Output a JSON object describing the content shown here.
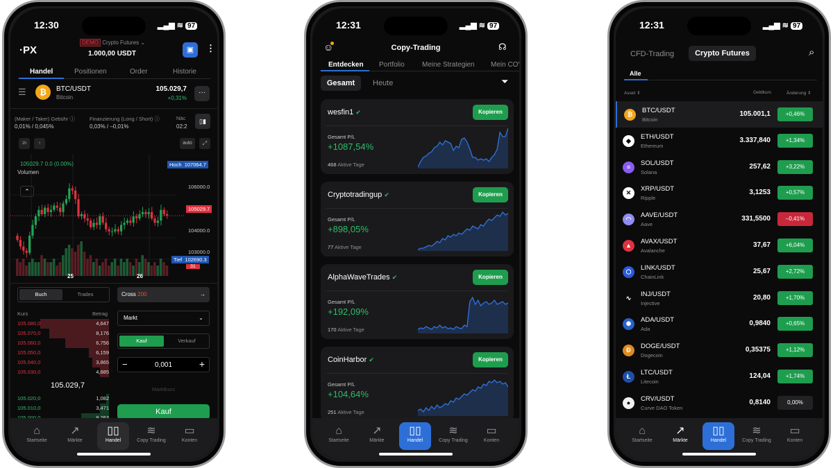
{
  "phone1": {
    "status": {
      "time": "12:30",
      "battery": "97"
    },
    "logo": "·PX",
    "account": {
      "badge": "DEMO",
      "product": "Crypto Futures",
      "balance": "1.000,00 USDT"
    },
    "tabs": [
      "Handel",
      "Positionen",
      "Order",
      "Historie"
    ],
    "pair": {
      "symbol": "BTC/USDT",
      "name": "Bitcoin",
      "price": "105.029,7",
      "change": "+0,31%"
    },
    "fees": {
      "label": "(Maker / Taker) Gebühr",
      "value": "0,01% / 0,045%"
    },
    "funding": {
      "label": "Finanzierung (Long / Short)",
      "value": "0,03% / –0,01%"
    },
    "next": {
      "label": "Näc",
      "value": "02:2"
    },
    "timeframe": "1h",
    "auto": "auto",
    "chart": {
      "last_line": "105029.7  0.0 (0.00%)",
      "volume_label": "Volumen",
      "high_label": "Hoch",
      "high": "107064.7",
      "low_label": "Tief",
      "low": "102690.3",
      "current": "105029.7",
      "countdown": "31",
      "axis": [
        "106000.0",
        "104000.0",
        "103000.0"
      ],
      "x_labels": [
        "25",
        "26"
      ],
      "closes": [
        103900,
        103600,
        103400,
        103300,
        104100,
        104600,
        105000,
        105300,
        105100,
        105400,
        105200,
        105300,
        105500,
        105400,
        105200,
        105600,
        105800,
        106300,
        106200,
        105800,
        105000,
        105100,
        104900,
        104800,
        104500,
        104700,
        104600,
        105000,
        104700,
        104400,
        104300,
        104300,
        104400,
        104300,
        104600,
        104700,
        104800,
        104700,
        105000,
        104900,
        105100,
        105200,
        105100,
        105200,
        104900,
        104700,
        104800,
        105300,
        105100,
        105030
      ],
      "volumes": [
        5,
        4,
        5,
        3,
        4,
        5,
        4,
        4,
        6,
        5,
        4,
        4,
        5,
        3,
        4,
        6,
        8,
        9,
        8,
        7,
        9,
        10,
        7,
        5,
        6,
        4,
        5,
        3,
        4,
        5,
        3,
        4,
        5,
        3,
        5,
        4,
        5,
        4,
        3,
        5,
        4,
        6,
        5,
        4,
        3,
        4,
        3,
        5,
        4,
        3
      ]
    },
    "book_tabs": [
      "Buch",
      "Trades"
    ],
    "book_headers": {
      "price": "Kurs",
      "amount": "Betrag"
    },
    "asks": [
      {
        "p": "105.080,0",
        "a": "4,647",
        "d": 0.75
      },
      {
        "p": "105.070,0",
        "a": "8,176",
        "d": 0.65
      },
      {
        "p": "105.060,0",
        "a": "6,756",
        "d": 0.48
      },
      {
        "p": "105.050,0",
        "a": "6,159",
        "d": 0.22
      },
      {
        "p": "105.040,0",
        "a": "3,865",
        "d": 0.18
      },
      {
        "p": "105.030,0",
        "a": "4,885",
        "d": 0.1
      }
    ],
    "mid": "105.029,7",
    "bids": [
      {
        "p": "105.020,0",
        "a": "1,082",
        "d": 0.03
      },
      {
        "p": "105.010,0",
        "a": "3,471",
        "d": 0.1
      },
      {
        "p": "105.000,0",
        "a": "9,763",
        "d": 0.3
      }
    ],
    "margin": {
      "mode": "Cross",
      "leverage": "200"
    },
    "order_type": "Markt",
    "side": {
      "buy": "Kauf",
      "sell": "Verkauf"
    },
    "qty": "0,001",
    "price_hint": "Marktkurs",
    "submit": "Kauf"
  },
  "phone2": {
    "status": {
      "time": "12:31",
      "battery": "97"
    },
    "title": "Copy-Trading",
    "tabs": [
      "Entdecken",
      "Portfolio",
      "Meine Strategien",
      "Mein COV"
    ],
    "filters": [
      "Gesamt",
      "Heute"
    ],
    "copy_label": "Kopieren",
    "pl_label": "Gesamt P/L",
    "days_label": "Aktive Tage",
    "traders": [
      {
        "name": "wesfin1",
        "pl": "+1087,54%",
        "days": "468",
        "spark": [
          0,
          8,
          14,
          16,
          20,
          22,
          28,
          30,
          36,
          32,
          38,
          36,
          34,
          24,
          30,
          28,
          40,
          42,
          36,
          26,
          14,
          14,
          10,
          12,
          10,
          12,
          8,
          14,
          18,
          26,
          50,
          44,
          44,
          56
        ]
      },
      {
        "name": "Cryptotradingup",
        "pl": "+898,05%",
        "days": "77",
        "spark": [
          0,
          2,
          2,
          4,
          6,
          5,
          8,
          12,
          10,
          16,
          14,
          20,
          18,
          22,
          20,
          24,
          22,
          26,
          30,
          28,
          34,
          32,
          30,
          36,
          34,
          40,
          44,
          42,
          46,
          50,
          48,
          54,
          50,
          52
        ]
      },
      {
        "name": "AlphaWaveTrades",
        "pl": "+192,09%",
        "days": "170",
        "spark": [
          4,
          6,
          5,
          8,
          6,
          4,
          8,
          6,
          10,
          6,
          8,
          5,
          6,
          4,
          8,
          6,
          5,
          10,
          8,
          44,
          50,
          40,
          46,
          38,
          42,
          44,
          40,
          42,
          46,
          40,
          42,
          44,
          40,
          42
        ]
      },
      {
        "name": "CoinHarbor",
        "pl": "+104,64%",
        "days": "251",
        "spark": [
          6,
          8,
          4,
          10,
          6,
          12,
          8,
          14,
          10,
          12,
          16,
          14,
          20,
          18,
          24,
          22,
          26,
          30,
          28,
          32,
          36,
          34,
          40,
          38,
          44,
          42,
          48,
          46,
          50,
          46,
          48,
          44,
          46,
          40
        ]
      }
    ]
  },
  "phone3": {
    "status": {
      "time": "12:31",
      "battery": "97"
    },
    "tabs": [
      "CFD-Trading",
      "Crypto Futures"
    ],
    "sub_tab": "Alle",
    "headers": {
      "asset": "Asset",
      "price": "Geldkurs",
      "change": "Änderung"
    },
    "assets": [
      {
        "s": "BTC/USDT",
        "n": "Bitcoin",
        "p": "105.001,1",
        "c": "+0,46%",
        "dir": "up",
        "color": "#f2a619",
        "g": "₿"
      },
      {
        "s": "ETH/USDT",
        "n": "Ethereum",
        "p": "3.337,840",
        "c": "+1,34%",
        "dir": "up",
        "color": "#ffffff",
        "g": "◆"
      },
      {
        "s": "SOL/USDT",
        "n": "Solana",
        "p": "257,62",
        "c": "+3,22%",
        "dir": "up",
        "color": "#8a5cf0",
        "g": "≡"
      },
      {
        "s": "XRP/USDT",
        "n": "Ripple",
        "p": "3,1253",
        "c": "+0,57%",
        "dir": "up",
        "color": "#ffffff",
        "g": "✕"
      },
      {
        "s": "AAVE/USDT",
        "n": "Aave",
        "p": "331,5500",
        "c": "–0,41%",
        "dir": "down",
        "color": "#8f8cf2",
        "g": "◠"
      },
      {
        "s": "AVAX/USDT",
        "n": "Avalanche",
        "p": "37,67",
        "c": "+6,04%",
        "dir": "up",
        "color": "#e0323f",
        "g": "▲"
      },
      {
        "s": "LINK/USDT",
        "n": "ChainLink",
        "p": "25,67",
        "c": "+2,72%",
        "dir": "up",
        "color": "#2a5ada",
        "g": "⬡"
      },
      {
        "s": "INJ/USDT",
        "n": "Injective",
        "p": "20,80",
        "c": "+1,70%",
        "dir": "up",
        "color": "#0b0b0c",
        "g": "∿"
      },
      {
        "s": "ADA/USDT",
        "n": "Ada",
        "p": "0,9840",
        "c": "+0,65%",
        "dir": "up",
        "color": "#2a62c9",
        "g": "✺"
      },
      {
        "s": "DOGE/USDT",
        "n": "Dogecoin",
        "p": "0,35375",
        "c": "+1,12%",
        "dir": "up",
        "color": "#e08a1e",
        "g": "Ð"
      },
      {
        "s": "LTC/USDT",
        "n": "Litecoin",
        "p": "124,04",
        "c": "+1,74%",
        "dir": "up",
        "color": "#1e4fa8",
        "g": "Ł"
      },
      {
        "s": "CRV/USDT",
        "n": "Curve DAO Token",
        "p": "0,8140",
        "c": "0,00%",
        "dir": "flat",
        "color": "#f0f0f0",
        "g": "●"
      }
    ]
  },
  "nav": [
    {
      "label": "Startseite",
      "icon": "home-icon",
      "g": "⌂"
    },
    {
      "label": "Märkte",
      "icon": "trend-icon",
      "g": "↗"
    },
    {
      "label": "Handel",
      "icon": "candles-icon",
      "g": "▯▯"
    },
    {
      "label": "Copy Trading",
      "icon": "layers-icon",
      "g": "≋"
    },
    {
      "label": "Konten",
      "icon": "wallet-icon",
      "g": "▭"
    }
  ],
  "colors": {
    "green": "#1f9d4e",
    "red": "#c8283a",
    "blue": "#2d6fd6",
    "bg": "#0b0b0c"
  }
}
